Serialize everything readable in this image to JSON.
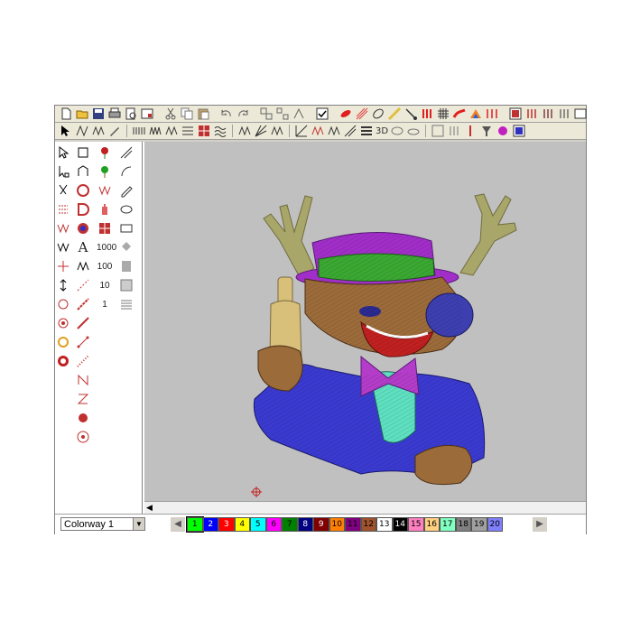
{
  "toolbar_top": {
    "icons": [
      "new-icon",
      "open-icon",
      "save-icon",
      "print-icon",
      "print-preview-icon",
      "properties-icon",
      "cut-icon",
      "copy-icon",
      "paste-icon",
      "undo-icon",
      "redo-icon",
      "group-icon",
      "ungroup-icon",
      "break-icon",
      "check-icon",
      "satin-icon",
      "fill-icon",
      "outline-icon",
      "line-icon",
      "needle-icon",
      "grid-icon",
      "stitch-icon",
      "appliqué-icon",
      "color-icon",
      "frame-icon",
      "view-icon",
      "zoom-icon",
      "stop-icon",
      "more-icon"
    ]
  },
  "toolbar_second": {
    "label_3d": "3D"
  },
  "bottom": {
    "colorway_value": "Colorway 1",
    "palette": [
      {
        "label": "1",
        "color": "#00ff00",
        "text": "#000000"
      },
      {
        "label": "2",
        "color": "#0000ff",
        "text": "#ffffff"
      },
      {
        "label": "3",
        "color": "#ff0000",
        "text": "#ffffff"
      },
      {
        "label": "4",
        "color": "#ffff00",
        "text": "#000000"
      },
      {
        "label": "5",
        "color": "#00ffff",
        "text": "#000000"
      },
      {
        "label": "6",
        "color": "#ff00ff",
        "text": "#000000"
      },
      {
        "label": "7",
        "color": "#008000",
        "text": "#000000"
      },
      {
        "label": "8",
        "color": "#000080",
        "text": "#ffffff"
      },
      {
        "label": "9",
        "color": "#800000",
        "text": "#ffffff"
      },
      {
        "label": "10",
        "color": "#ff8000",
        "text": "#000000"
      },
      {
        "label": "11",
        "color": "#800080",
        "text": "#000000"
      },
      {
        "label": "12",
        "color": "#a0522d",
        "text": "#000000"
      },
      {
        "label": "13",
        "color": "#ffffff",
        "text": "#000000"
      },
      {
        "label": "14",
        "color": "#000000",
        "text": "#ffffff"
      },
      {
        "label": "15",
        "color": "#ff80c0",
        "text": "#000000"
      },
      {
        "label": "16",
        "color": "#ffd080",
        "text": "#000000"
      },
      {
        "label": "17",
        "color": "#80ffc0",
        "text": "#000000"
      },
      {
        "label": "18",
        "color": "#808080",
        "text": "#000000"
      },
      {
        "label": "19",
        "color": "#a0a0a0",
        "text": "#000000"
      },
      {
        "label": "20",
        "color": "#8080ff",
        "text": "#000000"
      }
    ]
  }
}
